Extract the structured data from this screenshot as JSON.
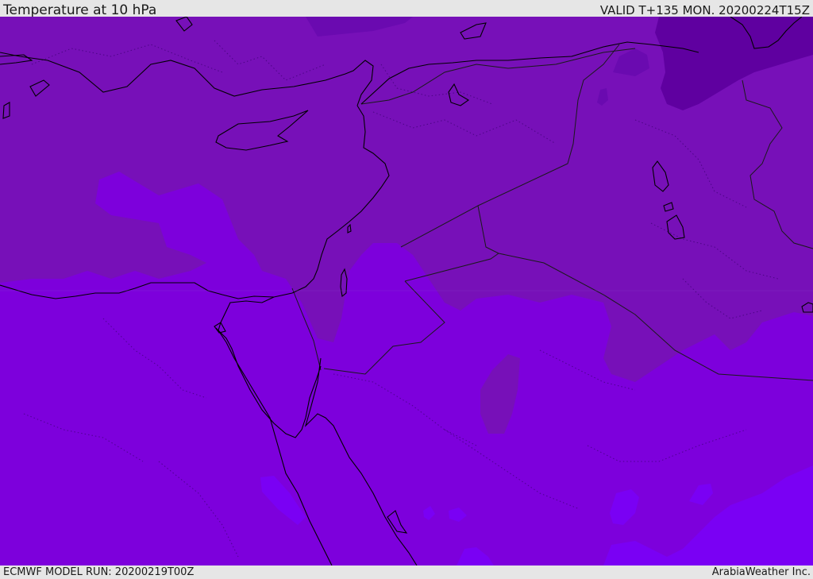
{
  "header": {
    "title": "Temperature at 10 hPa",
    "valid": "VALID T+135 MON. 20200224T15Z"
  },
  "footer": {
    "model_run": "ECMWF MODEL RUN: 20200219T00Z",
    "credit": "ArabiaWeather Inc."
  },
  "colors": {
    "frame_bg": "#e6e6e6",
    "level_cold": "#5f00a0",
    "level_mid": "#7710b8",
    "level_base": "#7d00dc",
    "level_warm": "#7a00f4",
    "coastline": "#000000",
    "border": "#1a1a1a"
  },
  "icons": {
    "map": "map-layer"
  }
}
